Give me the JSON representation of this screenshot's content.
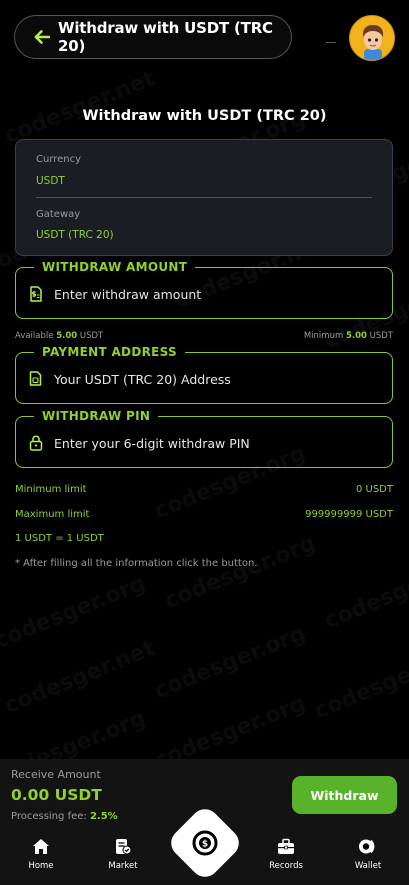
{
  "header": {
    "back_title": "Withdraw with USDT (TRC 20)"
  },
  "page_title": "Withdraw with USDT (TRC 20)",
  "info": {
    "currency_label": "Currency",
    "currency_value": "USDT",
    "gateway_label": "Gateway",
    "gateway_value": "USDT (TRC 20)"
  },
  "withdraw_amount": {
    "legend": "WITHDRAW AMOUNT",
    "placeholder": "Enter withdraw amount",
    "icon": "money-doc-icon"
  },
  "available": {
    "label": "Available",
    "value": "5.00",
    "unit": "USDT"
  },
  "minimum": {
    "label": "Minimum",
    "value": "5.00",
    "unit": "USDT"
  },
  "payment_address": {
    "legend": "PAYMENT ADDRESS",
    "placeholder": "Your USDT (TRC 20) Address",
    "icon": "sim-card-icon"
  },
  "withdraw_pin": {
    "legend": "WITHDRAW PIN",
    "placeholder": "Enter your 6-digit withdraw PIN",
    "icon": "lock-icon"
  },
  "limits": {
    "min_label": "Minimum limit",
    "min_value": "0 USDT",
    "max_label": "Maximum limit",
    "max_value": "999999999 USDT",
    "rate": "1 USDT = 1 USDT"
  },
  "note": "*  After filling all the information click the button.",
  "receive": {
    "label": "Receive Amount",
    "amount": "0.00 USDT",
    "fee_label": "Processing fee:",
    "fee_value": "2.5%"
  },
  "withdraw_button": "Withdraw",
  "bottom_nav": {
    "home": "Home",
    "market": "Market",
    "records": "Records",
    "wallet": "Wallet"
  },
  "watermark": "codesger.org",
  "watermark_alt": "codesger.net",
  "colors": {
    "accent": "#92d02a",
    "button": "#58b22a",
    "background": "#000000",
    "card": "#1a1d24"
  }
}
